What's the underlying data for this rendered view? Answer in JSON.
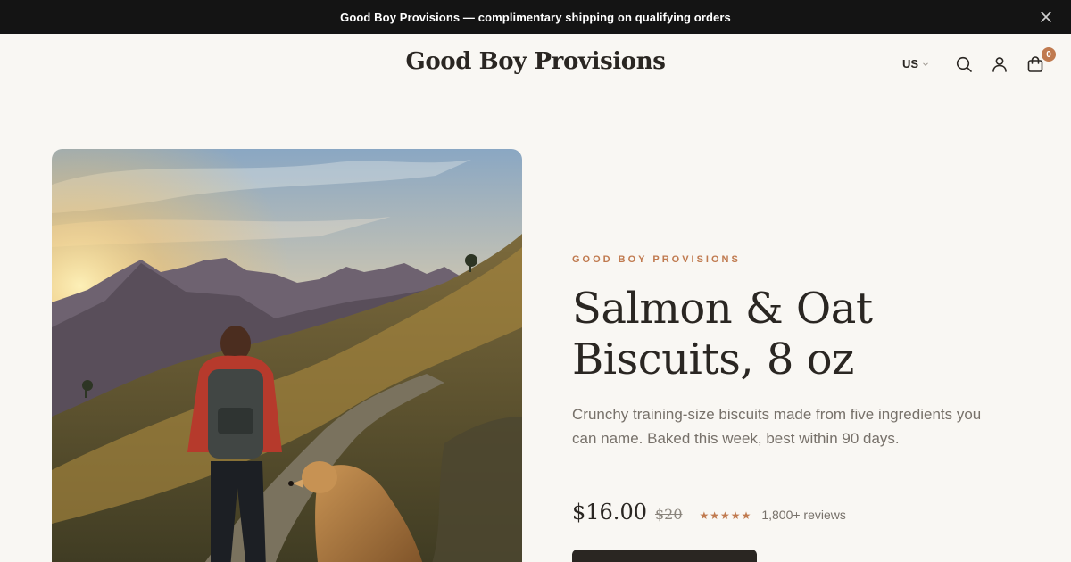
{
  "announcement": {
    "text": "Good Boy Provisions — complimentary shipping on qualifying orders",
    "close_icon": "close-icon"
  },
  "header": {
    "logo": "Good Boy Provisions",
    "region": "US",
    "icons": [
      "search-icon",
      "account-icon",
      "cart-icon"
    ],
    "cart_count": "0"
  },
  "product": {
    "eyebrow": "GOOD BOY PROVISIONS",
    "title": "Salmon & Oat Biscuits, 8 oz",
    "description": "Crunchy training-size biscuits made from five ingredients you can name. Baked this week, best within 90 days.",
    "price": "$16.00",
    "compare_price": "$20",
    "stars": "★★★★★",
    "reviews": "1,800+ reviews",
    "rating": 5
  },
  "colors": {
    "accent": "#c07a4f",
    "dark": "#2a2622",
    "background": "#f9f7f3",
    "announcement_bg": "#141414"
  }
}
